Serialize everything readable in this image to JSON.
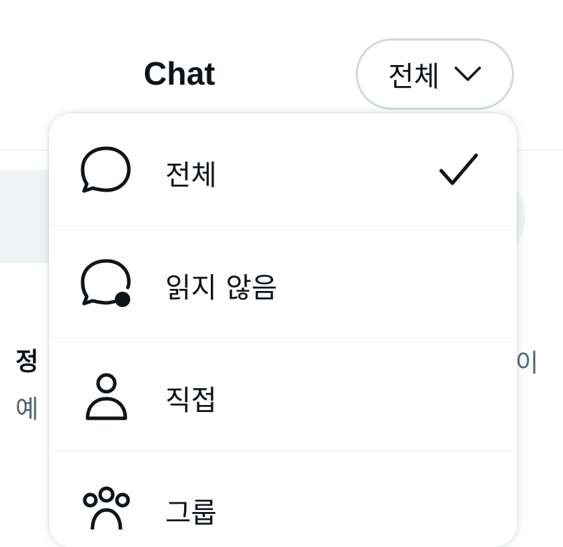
{
  "header": {
    "title": "Chat",
    "filter": {
      "selected_label": "전체",
      "icon": "chevron-down-icon"
    }
  },
  "background": {
    "row_title": "정",
    "row_subtitle": "예",
    "row_trailing": "이"
  },
  "menu": {
    "items": [
      {
        "label": "전체",
        "icon": "chat-bubble-icon",
        "selected": true
      },
      {
        "label": "읽지 않음",
        "icon": "chat-bubble-unread-icon",
        "selected": false
      },
      {
        "label": "직접",
        "icon": "person-icon",
        "selected": false
      },
      {
        "label": "그룹",
        "icon": "group-icon",
        "selected": false
      }
    ],
    "check_icon": "checkmark-icon"
  },
  "colors": {
    "text": "#0f1419",
    "secondary": "#536471",
    "border": "#cfd9de",
    "surface": "#eff3f4"
  }
}
